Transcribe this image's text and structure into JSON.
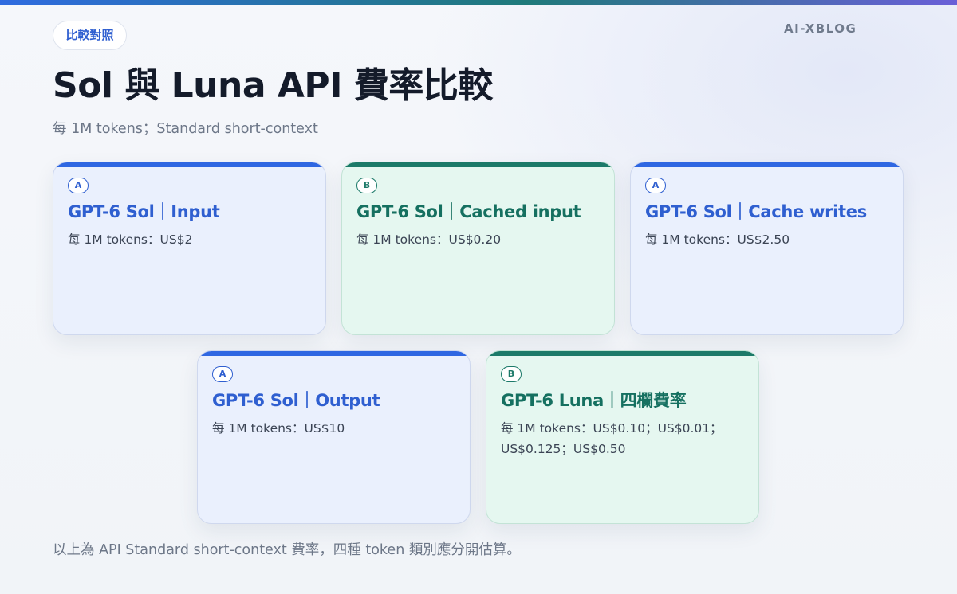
{
  "header": {
    "tag": "比較對照",
    "brand": "AI-XBLOG",
    "title": "Sol 與 Luna API 費率比較",
    "subtitle": "每 1M tokens；Standard short-context"
  },
  "cards": [
    {
      "badge": "A",
      "title": "GPT-6 Sol｜Input",
      "text": "每 1M tokens：US$2"
    },
    {
      "badge": "B",
      "title": "GPT-6 Sol｜Cached input",
      "text": "每 1M tokens：US$0.20"
    },
    {
      "badge": "A",
      "title": "GPT-6 Sol｜Cache writes",
      "text": "每 1M tokens：US$2.50"
    },
    {
      "badge": "A",
      "title": "GPT-6 Sol｜Output",
      "text": "每 1M tokens：US$10"
    },
    {
      "badge": "B",
      "title": "GPT-6 Luna｜四欄費率",
      "text": "每 1M tokens：US$0.10；US$0.01；US$0.125；US$0.50"
    }
  ],
  "footer": "以上為 API Standard short-context 費率，四種 token 類別應分開估算。",
  "colors": {
    "accent_a": "#2f67e2",
    "accent_b": "#1c7a69",
    "card_a_bg": "#eaf0fd",
    "card_b_bg": "#e5f7f0"
  }
}
